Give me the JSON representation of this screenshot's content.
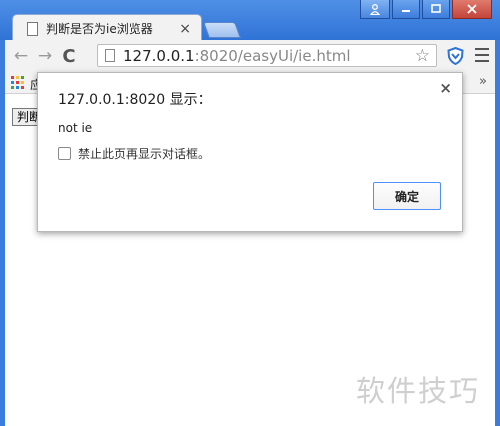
{
  "window": {
    "profile_icon": "person-icon",
    "minimize_icon": "minimize-icon",
    "maximize_icon": "maximize-icon",
    "close_icon": "close-icon"
  },
  "tab": {
    "title": "判断是否为ie浏览器",
    "close": "×"
  },
  "toolbar": {
    "back": "←",
    "forward": "→",
    "reload": "C",
    "url_host": "127.0.0.1",
    "url_rest": ":8020/easyUi/ie.html",
    "star": "☆",
    "accent": "#2f73d6"
  },
  "bookmarks": {
    "apps_label": "应",
    "more": "»"
  },
  "page": {
    "button_label": "判断"
  },
  "dialog": {
    "title": "127.0.0.1:8020 显示：",
    "close": "×",
    "message": "not ie",
    "checkbox_label": "禁止此页再显示对话框。",
    "checkbox_checked": false,
    "ok_label": "确定"
  },
  "watermark": "软件技巧"
}
